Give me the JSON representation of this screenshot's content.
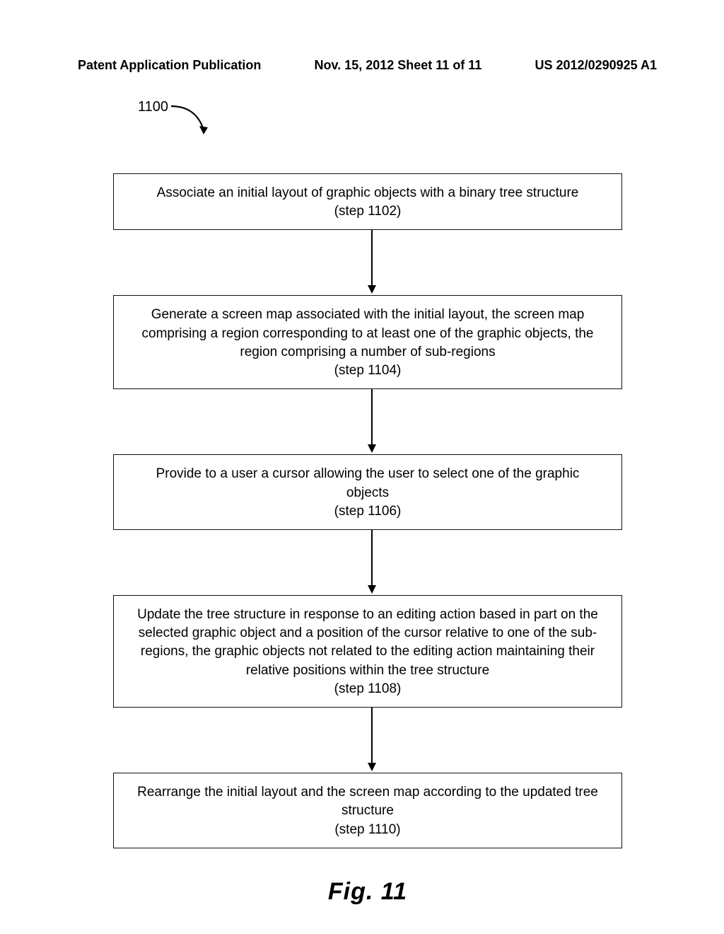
{
  "header": {
    "left": "Patent Application Publication",
    "center": "Nov. 15, 2012  Sheet 11 of 11",
    "right": "US 2012/0290925 A1"
  },
  "reference_label": "1100",
  "chart_data": {
    "type": "flowchart",
    "direction": "top-down",
    "nodes": [
      {
        "id": "1102",
        "text": "Associate an initial layout of graphic objects with a binary tree structure",
        "step": "(step 1102)"
      },
      {
        "id": "1104",
        "text": "Generate a screen map associated with the initial layout, the screen map comprising a region corresponding to at least one of the graphic objects, the region comprising a number of sub-regions",
        "step": "(step 1104)"
      },
      {
        "id": "1106",
        "text": "Provide to a user a cursor allowing the user to select one of the graphic objects",
        "step": "(step 1106)"
      },
      {
        "id": "1108",
        "text": "Update the tree structure in response to an editing action based in part on the selected graphic object and a position of the cursor relative to one of the sub-regions, the graphic objects not related to the editing action maintaining their relative positions within the tree structure",
        "step": "(step 1108)"
      },
      {
        "id": "1110",
        "text": "Rearrange the initial layout and the screen map according to the updated tree structure",
        "step": "(step 1110)"
      }
    ],
    "edges": [
      [
        "1102",
        "1104"
      ],
      [
        "1104",
        "1106"
      ],
      [
        "1106",
        "1108"
      ],
      [
        "1108",
        "1110"
      ]
    ]
  },
  "figure_caption": "Fig. 11"
}
